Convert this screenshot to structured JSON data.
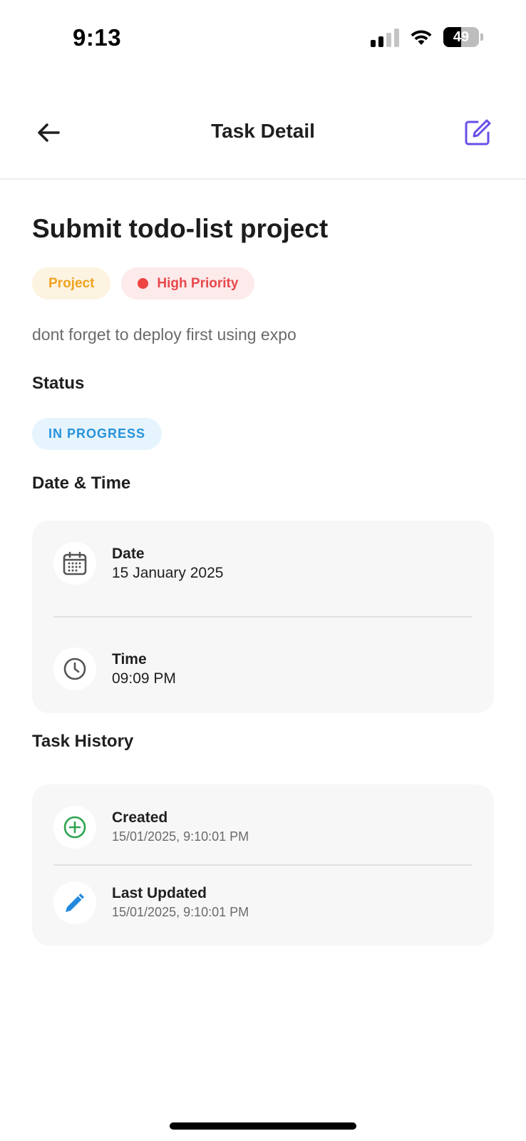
{
  "status_bar": {
    "time": "9:13",
    "battery": "49",
    "battery_level": 0.49
  },
  "header": {
    "title": "Task Detail",
    "back_icon": "arrow-left-icon",
    "edit_icon": "edit-square-icon",
    "accent_color": "#6a4ee8"
  },
  "task": {
    "title": "Submit todo-list project",
    "category": "Project",
    "priority": "High Priority",
    "description": "dont forget to deploy first using expo"
  },
  "status": {
    "label": "Status",
    "value": "IN PROGRESS"
  },
  "datetime": {
    "label": "Date & Time",
    "date_label": "Date",
    "date_value": "15 January 2025",
    "time_label": "Time",
    "time_value": "09:09 PM"
  },
  "history": {
    "label": "Task History",
    "created_label": "Created",
    "created_value": "15/01/2025, 9:10:01 PM",
    "updated_label": "Last Updated",
    "updated_value": "15/01/2025, 9:10:01 PM"
  },
  "colors": {
    "category_text": "#f0a21f",
    "priority_text": "#e8484c",
    "status_text": "#2793d9",
    "created_icon": "#2ea44f",
    "updated_icon": "#2389e0"
  }
}
